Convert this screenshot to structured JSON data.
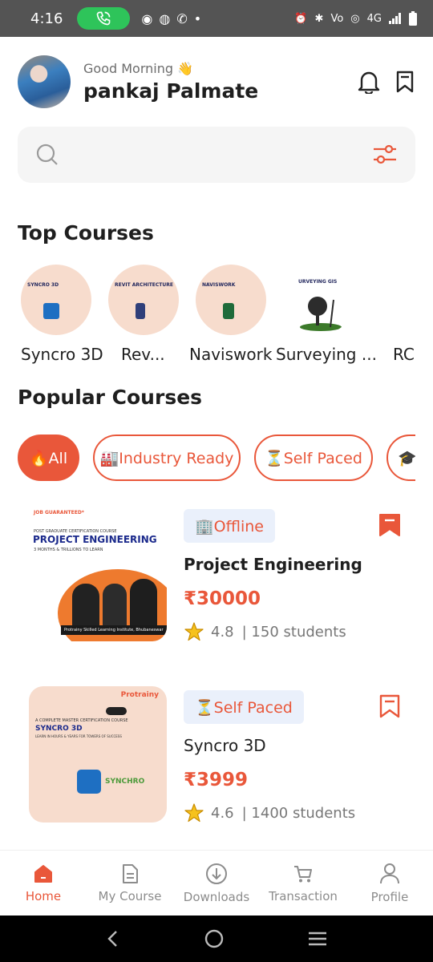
{
  "status": {
    "time": "4:16",
    "network": "4G"
  },
  "header": {
    "greeting": "Good Morning 👋",
    "user_name": "pankaj Palmate"
  },
  "search": {
    "placeholder": ""
  },
  "top_courses": {
    "title": "Top Courses",
    "items": [
      {
        "label": "Syncro 3D",
        "banner": "SYNCRO 3D"
      },
      {
        "label": "Rev...",
        "banner": "REVIT ARCHITECTURE"
      },
      {
        "label": "Naviswork",
        "banner": "NAVISWORK"
      },
      {
        "label": "Surveying ...",
        "banner": "URVEYING GIS"
      },
      {
        "label": "RC",
        "banner": ""
      }
    ]
  },
  "popular_courses": {
    "title": "Popular Courses",
    "filters": [
      {
        "label": "🔥All",
        "active": true
      },
      {
        "label": "🏭Industry Ready",
        "active": false
      },
      {
        "label": "⏳Self Paced",
        "active": false
      },
      {
        "label": "🎓",
        "active": false
      }
    ],
    "courses": [
      {
        "badge": "🏢Offline",
        "title": "Project Engineering",
        "price": "₹30000",
        "rating": "4.8",
        "students": "| 150 students",
        "thumb_tag": "JOB GUARANTEED*",
        "thumb_sub": "POST GRADUATE CERTIFICATION COURSE",
        "thumb_title": "PROJECT ENGINEERING",
        "thumb_tagline": "3 MONTHS & TRILLIONS TO LEARN",
        "thumb_footer": "Protrainy Skilled Learning Institute, Bhubaneswar"
      },
      {
        "badge": "⏳Self Paced",
        "title": "Syncro 3D",
        "price": "₹3999",
        "rating": "4.6",
        "students": "| 1400 students",
        "thumb_tag": "Protrainy",
        "thumb_sub": "A COMPLETE MASTER CERTIFICATION COURSE",
        "thumb_title": "SYNCRO 3D",
        "thumb_tagline": "LEARN IN HOURS & YEARS FOR TOWERS OF SUCCESS",
        "thumb_footer": "SYNCHRO"
      }
    ]
  },
  "bottom_nav": [
    {
      "label": "Home",
      "active": true
    },
    {
      "label": "My Course",
      "active": false
    },
    {
      "label": "Downloads",
      "active": false
    },
    {
      "label": "Transaction",
      "active": false
    },
    {
      "label": "Profile",
      "active": false
    }
  ],
  "colors": {
    "accent": "#e9573a",
    "status_bar": "#545454",
    "call_pill": "#2ec45a"
  }
}
